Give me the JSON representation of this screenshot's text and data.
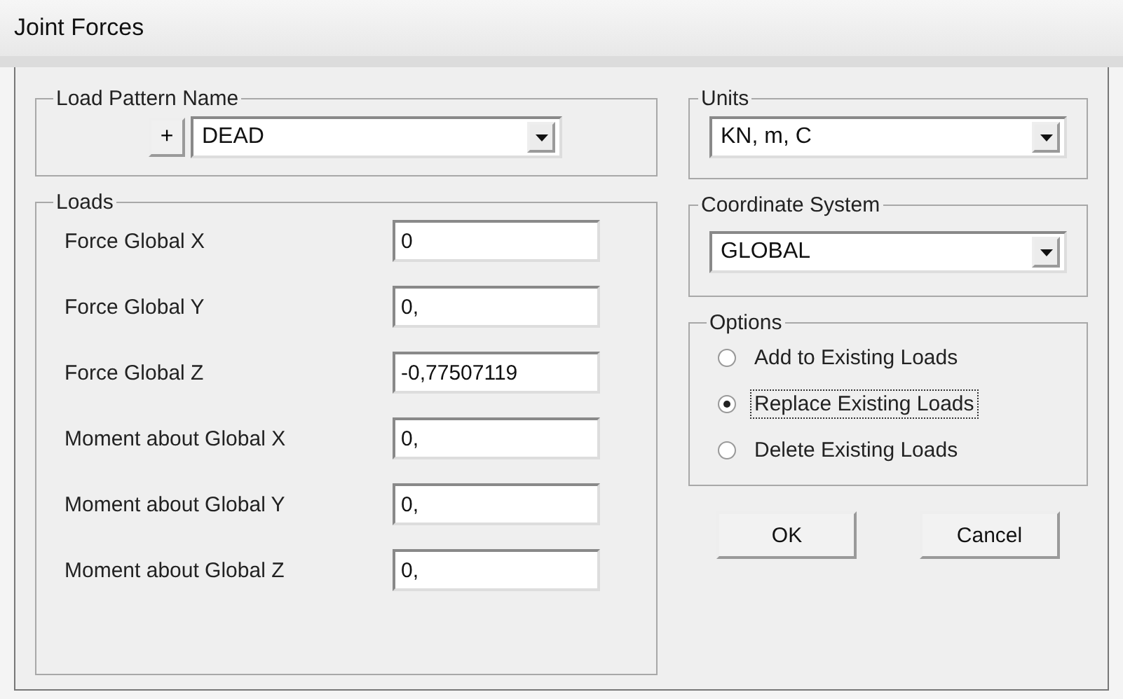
{
  "window": {
    "title": "Joint Forces"
  },
  "load_pattern": {
    "legend": "Load Pattern Name",
    "add_button": "+",
    "value": "DEAD"
  },
  "loads": {
    "legend": "Loads",
    "rows": [
      {
        "label": "Force Global X",
        "value": "0"
      },
      {
        "label": "Force Global Y",
        "value": "0,"
      },
      {
        "label": "Force Global Z",
        "value": "-0,77507119"
      },
      {
        "label": "Moment about Global X",
        "value": "0,"
      },
      {
        "label": "Moment about Global Y",
        "value": "0,"
      },
      {
        "label": "Moment about Global Z",
        "value": "0,"
      }
    ]
  },
  "units": {
    "legend": "Units",
    "value": "KN, m, C"
  },
  "coordinate_system": {
    "legend": "Coordinate System",
    "value": "GLOBAL"
  },
  "options": {
    "legend": "Options",
    "items": [
      {
        "label": "Add to Existing Loads",
        "selected": false
      },
      {
        "label": "Replace Existing Loads",
        "selected": true
      },
      {
        "label": "Delete Existing Loads",
        "selected": false
      }
    ]
  },
  "buttons": [
    "OK",
    "Cancel"
  ]
}
